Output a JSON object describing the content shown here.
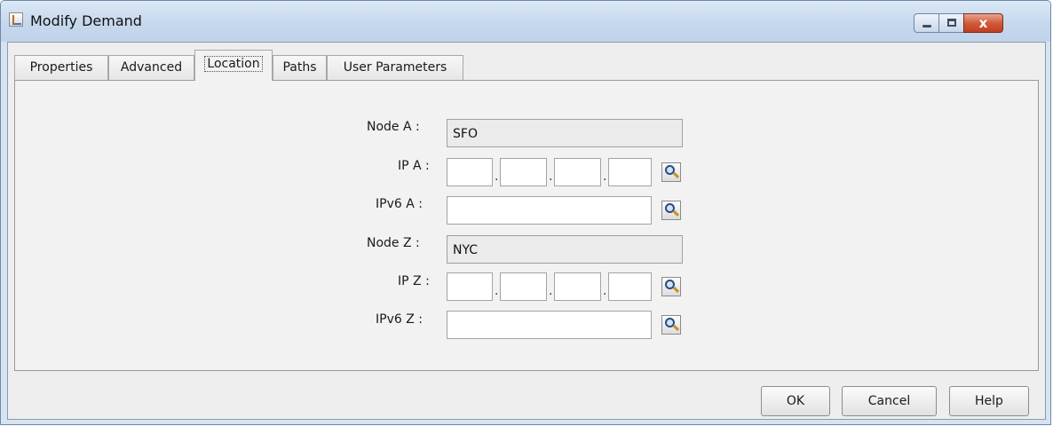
{
  "window": {
    "title": "Modify Demand",
    "controls": {
      "minimize": "minimize",
      "maximize": "maximize",
      "close": "x"
    }
  },
  "tabs": [
    {
      "label": "Properties",
      "active": false
    },
    {
      "label": "Advanced",
      "active": false
    },
    {
      "label": "Location",
      "active": true
    },
    {
      "label": "Paths",
      "active": false
    },
    {
      "label": "User Parameters",
      "active": false
    }
  ],
  "form": {
    "node_a": {
      "label": "Node A :",
      "value": "SFO"
    },
    "ip_a": {
      "label": "IP A :",
      "octets": [
        "",
        "",
        "",
        ""
      ]
    },
    "ipv6_a": {
      "label": "IPv6 A :",
      "value": ""
    },
    "node_z": {
      "label": "Node Z :",
      "value": "NYC"
    },
    "ip_z": {
      "label": "IP Z :",
      "octets": [
        "",
        "",
        "",
        ""
      ]
    },
    "ipv6_z": {
      "label": "IPv6 Z :",
      "value": ""
    },
    "octet_separator": "."
  },
  "buttons": {
    "ok": "OK",
    "cancel": "Cancel",
    "help": "Help"
  },
  "icons": {
    "lookup": "search-icon",
    "app": "java-app-icon"
  },
  "colors": {
    "titlebar": "#c6d8ec",
    "close": "#c13f21",
    "panel": "#f2f2f2"
  }
}
